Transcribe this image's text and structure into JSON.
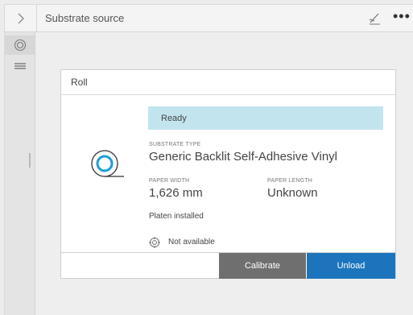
{
  "header": {
    "nav_icon": "chevron-right-icon",
    "title": "Substrate source",
    "pen_icon": "signature-pen-icon",
    "more_icon": "more-dots-icon",
    "more_glyph": "•••"
  },
  "sidebar": {
    "items": [
      {
        "icon": "roll-target-icon",
        "active": true
      },
      {
        "icon": "stack-list-icon",
        "active": false
      }
    ]
  },
  "card": {
    "title": "Roll",
    "status": "Ready",
    "status_color": "#c2e4ee",
    "substrate_type_label": "SUBSTRATE TYPE",
    "substrate_type": "Generic Backlit Self-Adhesive Vinyl",
    "paper_width_label": "PAPER WIDTH",
    "paper_width": "1,626 mm",
    "paper_length_label": "PAPER LENGTH",
    "paper_length": "Unknown",
    "platen": "Platen installed",
    "calibration_status": "Not available",
    "buttons": {
      "calibrate": "Calibrate",
      "unload": "Unload"
    },
    "accent_color": "#1c75bc"
  }
}
